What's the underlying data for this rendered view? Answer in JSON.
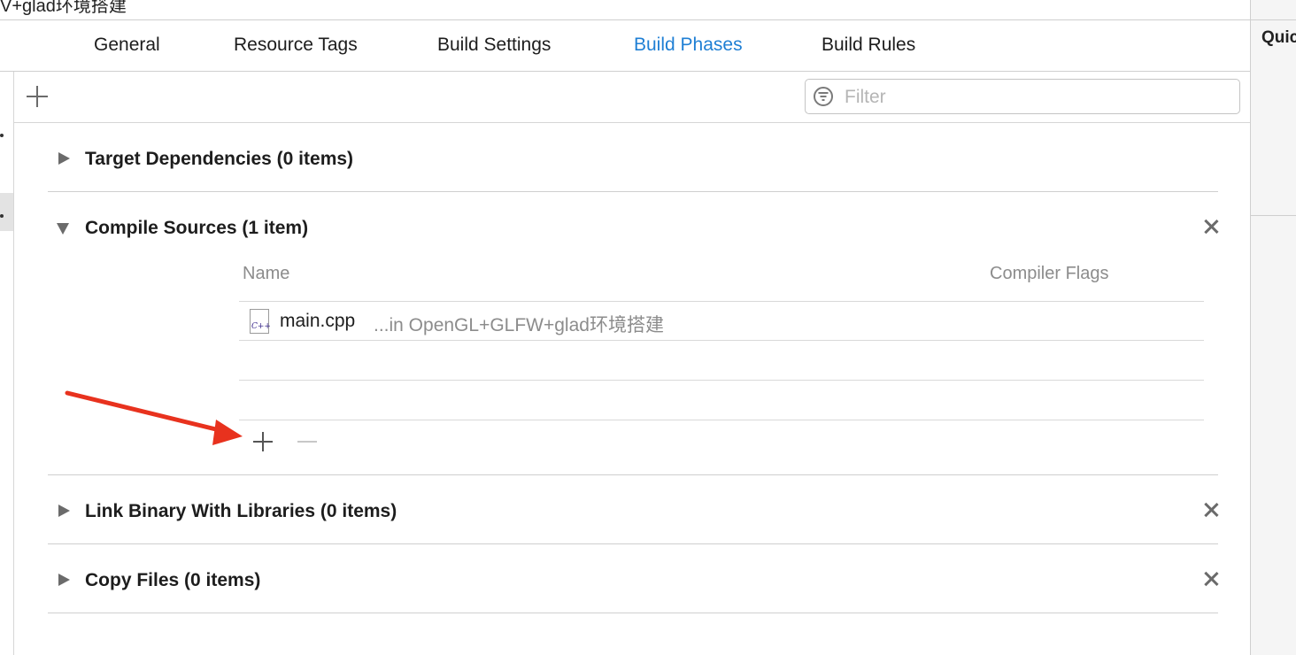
{
  "window": {
    "title_fragment": "V+glad环境搭建"
  },
  "tabs": [
    {
      "label": "General",
      "active": false
    },
    {
      "label": "Resource Tags",
      "active": false
    },
    {
      "label": "Build Settings",
      "active": false
    },
    {
      "label": "Build Phases",
      "active": true
    },
    {
      "label": "Build Rules",
      "active": false
    }
  ],
  "toolbar": {
    "filter_placeholder": "Filter"
  },
  "inspector": {
    "label": "Quic"
  },
  "phases": {
    "target_dependencies": {
      "title": "Target Dependencies (0 items)",
      "expanded": false
    },
    "compile_sources": {
      "title": "Compile Sources (1 item)",
      "expanded": true,
      "columns": {
        "name": "Name",
        "flags": "Compiler Flags"
      },
      "files": [
        {
          "name": "main.cpp",
          "location": "...in OpenGL+GLFW+glad环境搭建",
          "icon": "cpp-file-icon"
        }
      ]
    },
    "link_binary": {
      "title": "Link Binary With Libraries (0 items)",
      "expanded": false
    },
    "copy_files": {
      "title": "Copy Files (0 items)",
      "expanded": false
    }
  },
  "colors": {
    "accent": "#1f7fd4",
    "annotation_arrow": "#e8321e"
  }
}
